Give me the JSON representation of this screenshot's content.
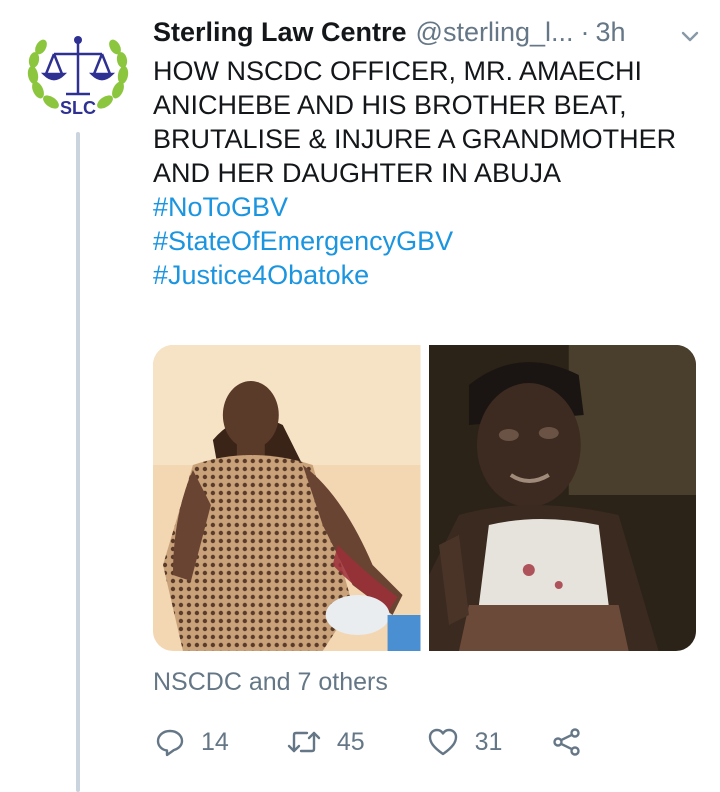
{
  "tweet": {
    "author_name": "Sterling Law Centre",
    "handle": "@sterling_l...",
    "separator": "·",
    "time": "3h",
    "text_lines": [
      "HOW NSCDC OFFICER, MR. AMAECHI",
      "ANICHEBE AND HIS BROTHER BEAT,",
      "BRUTALISE & INJURE A GRANDMOTHER",
      "AND HER DAUGHTER IN ABUJA"
    ],
    "hashtags": [
      "#NoToGBV",
      "#StateOfEmergencyGBV",
      "#Justice4Obatoke"
    ]
  },
  "avatar": {
    "logo_text": "SLC",
    "colors": {
      "laurel": "#8cc63f",
      "scale": "#2e3192"
    }
  },
  "liked_by": "NSCDC and 7 others",
  "actions": {
    "reply_count": "14",
    "retweet_count": "45",
    "like_count": "31"
  },
  "colors": {
    "hashtag": "#1b95e0",
    "secondary_text": "#657786",
    "thread_line": "#c9d4de"
  },
  "icons": [
    "laurel-scale-logo",
    "chevron-down-icon",
    "reply-icon",
    "retweet-icon",
    "heart-icon",
    "share-icon"
  ]
}
